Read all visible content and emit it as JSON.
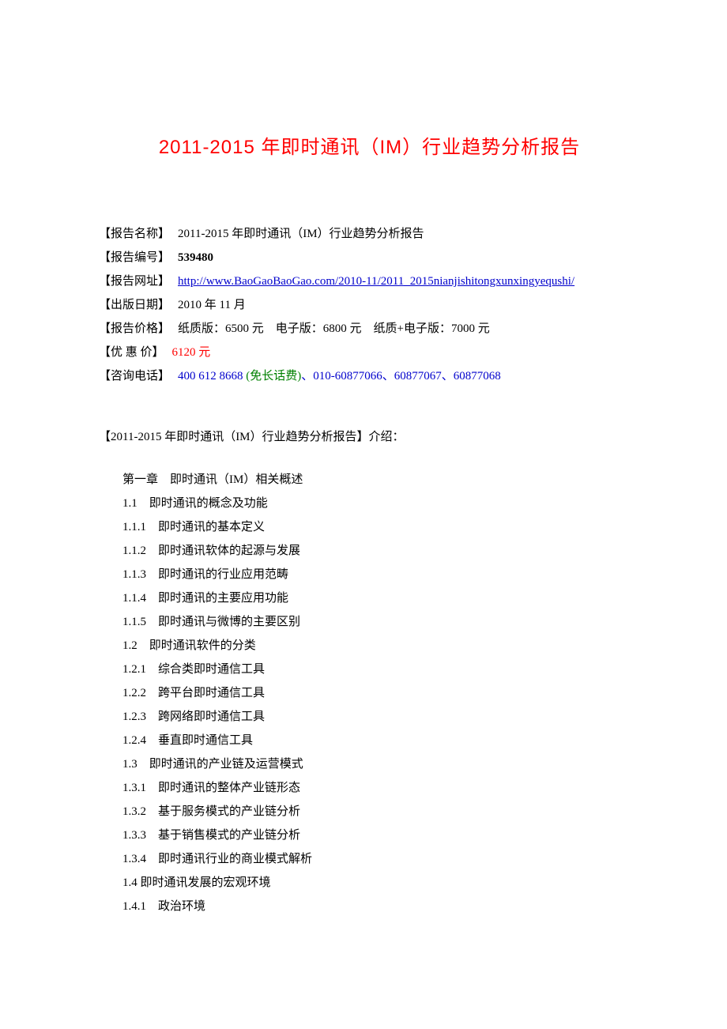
{
  "title": "2011-2015 年即时通讯（IM）行业趋势分析报告",
  "meta": {
    "name_label": "【报告名称】",
    "name_value": "2011-2015 年即时通讯（IM）行业趋势分析报告",
    "id_label": "【报告编号】",
    "id_value": "539480",
    "url_label": "【报告网址】",
    "url_value": "http://www.BaoGaoBaoGao.com/2010-11/2011_2015nianjishitongxunxingyequshi/",
    "date_label": "【出版日期】",
    "date_value": "2010 年 11 月",
    "price_label": "【报告价格】",
    "price_value": "纸质版：6500 元　电子版：6800 元　纸质+电子版：7000 元",
    "discount_label": "【优 惠 价】",
    "discount_value": "6120 元",
    "phone_label": "【咨询电话】",
    "phone_main": "400 612 8668 ",
    "phone_note": "(免长话费)",
    "phone_rest": "、010-60877066、60877067、60877068"
  },
  "intro_heading": "【2011-2015 年即时通讯（IM）行业趋势分析报告】介绍：",
  "toc": [
    "第一章　即时通讯（IM）相关概述",
    "1.1　即时通讯的概念及功能",
    "1.1.1　即时通讯的基本定义",
    "1.1.2　即时通讯软体的起源与发展",
    "1.1.3　即时通讯的行业应用范畴",
    "1.1.4　即时通讯的主要应用功能",
    "1.1.5　即时通讯与微博的主要区别",
    "1.2　即时通讯软件的分类",
    "1.2.1　综合类即时通信工具",
    "1.2.2　跨平台即时通信工具",
    "1.2.3　跨网络即时通信工具",
    "1.2.4　垂直即时通信工具",
    "1.3　即时通讯的产业链及运营模式",
    "1.3.1　即时通讯的整体产业链形态",
    "1.3.2　基于服务模式的产业链分析",
    "1.3.3　基于销售模式的产业链分析",
    "1.3.4　即时通讯行业的商业模式解析",
    "1.4 即时通讯发展的宏观环境",
    "1.4.1　政治环境"
  ]
}
